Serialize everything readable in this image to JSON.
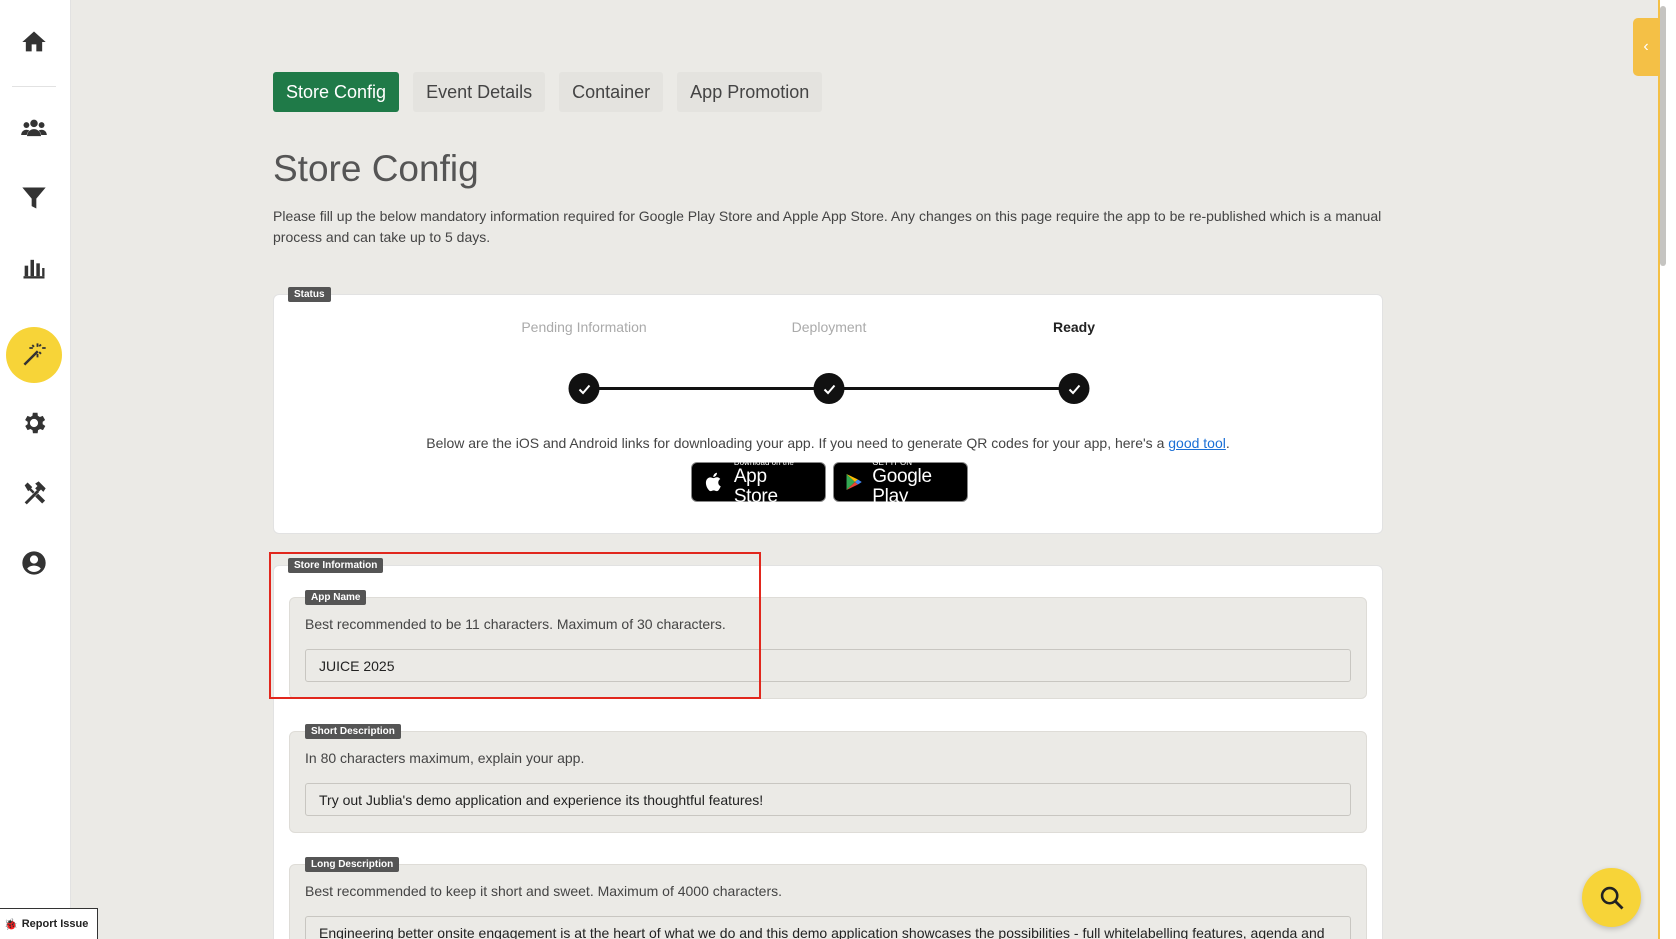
{
  "sidebar": {
    "items": [
      {
        "icon": "home-icon"
      },
      {
        "icon": "users-icon"
      },
      {
        "icon": "filter-icon"
      },
      {
        "icon": "bar-chart-icon"
      },
      {
        "icon": "magic-wand-icon",
        "active": true
      },
      {
        "icon": "gear-icon"
      },
      {
        "icon": "tools-icon"
      },
      {
        "icon": "account-icon"
      }
    ],
    "active_color": "#f7d438"
  },
  "report_issue": {
    "label": "Report Issue"
  },
  "tabs": [
    {
      "label": "Store Config",
      "active": true
    },
    {
      "label": "Event Details"
    },
    {
      "label": "Container"
    },
    {
      "label": "App Promotion"
    }
  ],
  "page": {
    "title": "Store Config",
    "description": "Please fill up the below mandatory information required for Google Play Store and Apple App Store. Any changes on this page require the app to be re-published which is a manual process and can take up to 5 days."
  },
  "status": {
    "legend": "Status",
    "steps": [
      {
        "label": "Pending Information",
        "done": true
      },
      {
        "label": "Deployment",
        "done": true
      },
      {
        "label": "Ready",
        "done": true,
        "current": true
      }
    ],
    "download_text": "Below are the iOS and Android links for downloading your app. If you need to generate QR codes for your app, here's a",
    "link_text": "good tool",
    "link_suffix": ".",
    "app_store": {
      "small": "Download on the",
      "big": "App Store"
    },
    "google_play": {
      "small": "GET IT ON",
      "big": "Google Play"
    }
  },
  "store_information": {
    "legend": "Store Information",
    "fields": [
      {
        "legend": "App Name",
        "help": "Best recommended to be 11 characters. Maximum of 30 characters.",
        "value": "JUICE 2025"
      },
      {
        "legend": "Short Description",
        "help": "In 80 characters maximum, explain your app.",
        "value": "Try out Jublia's demo application and experience its thoughtful features!"
      },
      {
        "legend": "Long Description",
        "help": "Best recommended to keep it short and sweet. Maximum of 4000 characters.",
        "value": "Engineering better onsite engagement is at the heart of what we do and this demo application showcases the possibilities - full whitelabelling features, agenda and"
      }
    ]
  },
  "colors": {
    "primary_tab": "#1f7a48",
    "accent": "#f7d438",
    "link": "#1a6fd6",
    "highlight": "#e1271d"
  }
}
